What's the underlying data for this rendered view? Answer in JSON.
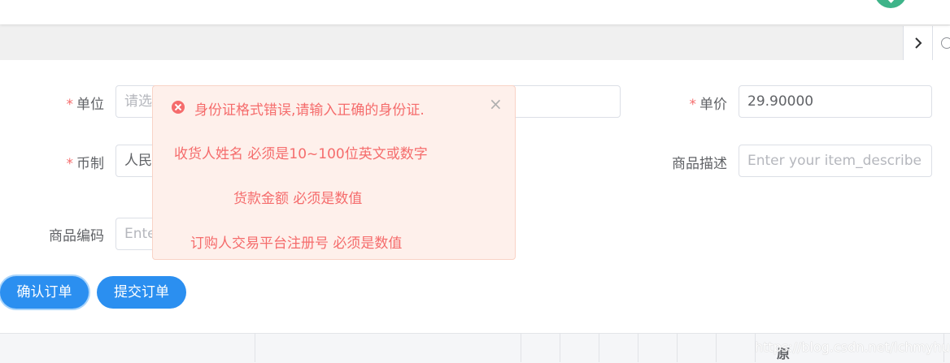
{
  "form": {
    "unit_label": "单位",
    "unit_placeholder": "请选",
    "currency_label": "币制",
    "currency_value": "人民",
    "code_label": "商品编码",
    "code_placeholder": "Ente",
    "price_label": "单价",
    "price_value": "29.90000",
    "desc_label": "商品描述",
    "desc_placeholder": "Enter your item_describe",
    "required_mark": "*"
  },
  "buttons": {
    "confirm_label": "确认订单",
    "submit_label": "提交订单"
  },
  "message": {
    "title": "身份证格式错误,请输入正确的身份证.",
    "lines": [
      "收货人姓名 必须是10~100位英文或数字",
      "货款金额 必须是数值",
      "订购人交易平台注册号 必须是数值"
    ],
    "close_glyph": "×"
  },
  "table": {
    "header_partial": "原"
  },
  "watermark": "https://blog.csdn.net/lchmyhua88",
  "colors": {
    "primary": "#2b8ff0",
    "error": "#f56c6c",
    "error_bg": "#fef0eb"
  },
  "icons": {
    "tab_next": "chevron-right-icon",
    "tab_close": "circle-close-icon",
    "message": "error-circle-icon",
    "user": "avatar"
  }
}
